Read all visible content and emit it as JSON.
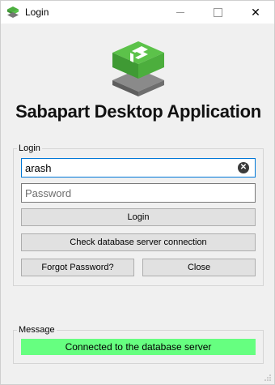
{
  "window": {
    "title": "Login",
    "minimize_icon": "minimize-icon",
    "maximize_icon": "maximize-icon",
    "close_glyph": "✕"
  },
  "brand": {
    "app_name": "Sabapart Desktop Application",
    "logo_icon": "sabapart-logo-icon",
    "colors": {
      "logo_green": "#4caf3f",
      "logo_gray": "#7a7a7a"
    }
  },
  "login_group": {
    "label": "Login",
    "username": {
      "value": "arash",
      "placeholder": ""
    },
    "password": {
      "value": "",
      "placeholder": "Password"
    },
    "clear_glyph": "✕",
    "buttons": {
      "login": "Login",
      "check_connection": "Check database server connection",
      "forgot_password": "Forgot Password?",
      "close": "Close"
    }
  },
  "message_group": {
    "label": "Message",
    "status_text": "Connected to the database server",
    "status_color": "#66ff80"
  }
}
